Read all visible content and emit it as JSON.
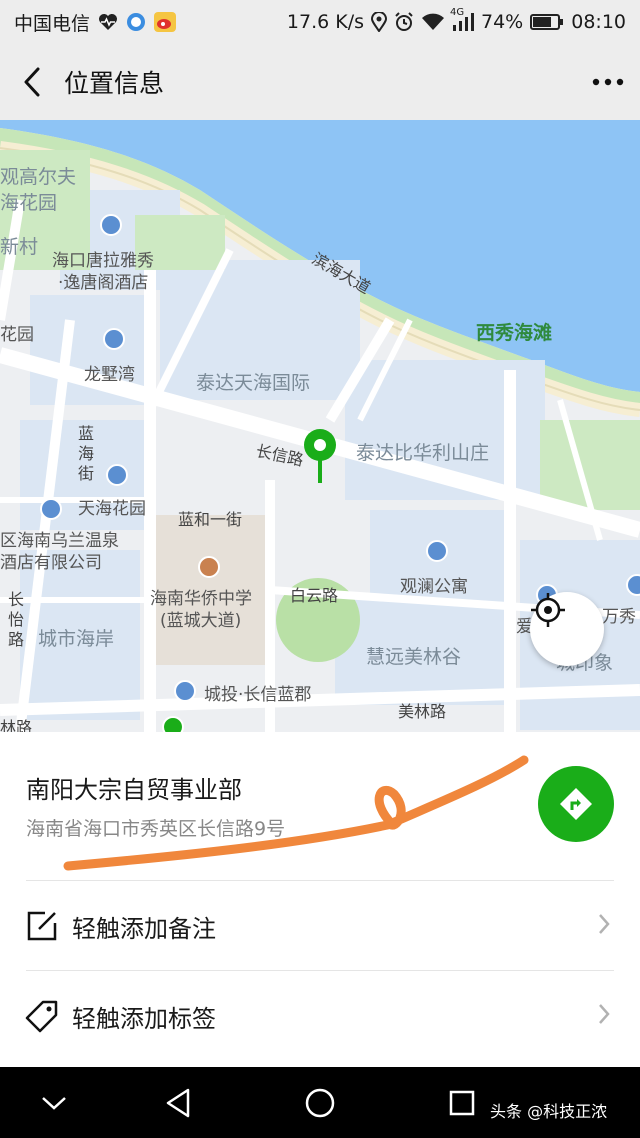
{
  "status_bar": {
    "carrier": "中国电信",
    "speed": "17.6 K/s",
    "network": "4G",
    "battery": "74%",
    "time": "08:10"
  },
  "header": {
    "title": "位置信息"
  },
  "map": {
    "labels": {
      "golf_a": "观高尔夫",
      "golf_b": "海花园",
      "xincun": "新村",
      "hotel_a": "海口唐拉雅秀",
      "hotel_b": "·逸唐阁酒店",
      "binhai_road": "滨海大道",
      "xixiu_beach": "西秀海滩",
      "huayuan": "花园",
      "longshu_bay": "龙墅湾",
      "taida_tianhai": "泰达天海国际",
      "changxin_road": "长信路",
      "taida_bihua": "泰达比华利山庄",
      "lanhai_street": "蓝海街",
      "tianhai_garden": "天海花园",
      "hotspring_a": "区海南乌兰温泉",
      "hotspring_b": "酒店有限公司",
      "lanhe_street": "蓝和一街",
      "school_a": "海南华侨中学",
      "school_b": "(蓝城大道)",
      "baiyun_road": "白云路",
      "guanlan": "观澜公寓",
      "chang_ling": "长怡路",
      "city_coast": "城市海岸",
      "huiyuan": "慧远美林谷",
      "wanxiu": "万秀",
      "chengyin": "城印象",
      "chengtou": "城投·长信蓝郡",
      "meilin_road": "美林路",
      "lin_road": "林路",
      "ai": "爱"
    }
  },
  "place": {
    "name": "南阳大宗自贸事业部",
    "address": "海南省海口市秀英区长信路9号"
  },
  "actions": [
    {
      "label": "轻触添加备注",
      "icon": "edit-icon"
    },
    {
      "label": "轻触添加标签",
      "icon": "tag-icon"
    }
  ],
  "watermark": "头条 @科技正浓",
  "colors": {
    "accent_green": "#1aad19",
    "water": "#8ec4f5",
    "scribble": "#f0873c"
  }
}
